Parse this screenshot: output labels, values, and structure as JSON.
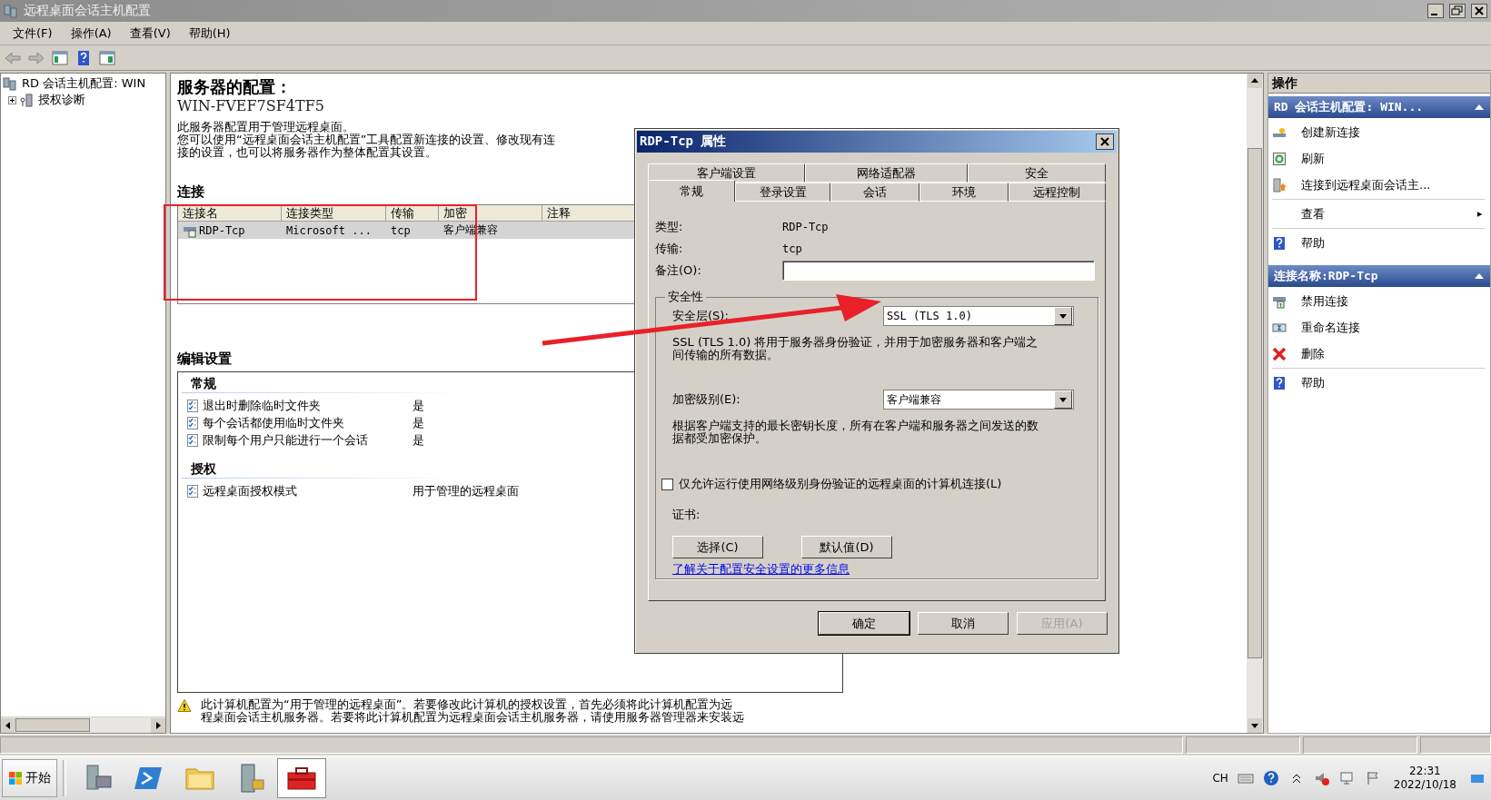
{
  "window": {
    "title": "远程桌面会话主机配置"
  },
  "menu": [
    "文件(F)",
    "操作(A)",
    "查看(V)",
    "帮助(H)"
  ],
  "tree": [
    {
      "label": "RD 会话主机配置: WIN",
      "selected": false,
      "children": [
        {
          "label": "授权诊断",
          "selected": false,
          "expanded": false
        }
      ]
    }
  ],
  "server": {
    "heading": "服务器的配置：",
    "name": "WIN-FVEF7SF4TF5",
    "description": [
      "此服务器配置用于管理远程桌面。",
      "您可以使用“远程桌面会话主机配置”工具配置新连接的设置、修改现有连",
      "接的设置，也可以将服务器作为整体配置其设置。"
    ]
  },
  "connections": {
    "title": "连接",
    "columns": [
      "连接名",
      "连接类型",
      "传输",
      "加密",
      "注释"
    ],
    "rows": [
      {
        "cells": [
          "RDP-Tcp",
          "Microsoft ...",
          "tcp",
          "客户端兼容"
        ],
        "selected": true
      }
    ]
  },
  "edit_settings": {
    "title": "编辑设置",
    "sections": [
      {
        "title": "常规",
        "items": [
          {
            "label": "退出时删除临时文件夹",
            "value": "是"
          },
          {
            "label": "每个会话都使用临时文件夹",
            "value": "是"
          },
          {
            "label": "限制每个用户只能进行一个会话",
            "value": "是"
          }
        ]
      },
      {
        "title": "授权",
        "items": [
          {
            "label": "远程桌面授权模式",
            "value": "用于管理的远程桌面"
          }
        ]
      }
    ]
  },
  "notice": [
    "此计算机配置为“用于管理的远程桌面”。若要修改此计算机的授权设置，首先必须将此计算机配置为远",
    "程桌面会话主机服务器。若要将此计算机配置为远程桌面会话主机服务器，请使用服务器管理器来安装远"
  ],
  "actions": {
    "title": "操作",
    "groups": [
      {
        "title": "RD 会话主机配置: WIN...",
        "expanded": true,
        "sections": [
          [
            {
              "label": "创建新连接",
              "submenu": false
            },
            {
              "label": "刷新",
              "submenu": false
            },
            {
              "label": "连接到远程桌面会话主...",
              "submenu": false
            }
          ],
          [
            {
              "label": "查看",
              "submenu": true
            }
          ],
          [
            {
              "label": "帮助",
              "submenu": false
            }
          ]
        ]
      },
      {
        "title": "连接名称:RDP-Tcp",
        "expanded": true,
        "sections": [
          [
            {
              "label": "禁用连接",
              "submenu": false
            },
            {
              "label": "重命名连接",
              "submenu": false
            },
            {
              "label": "删除",
              "submenu": false
            }
          ],
          [
            {
              "label": "帮助",
              "submenu": false
            }
          ]
        ]
      }
    ]
  },
  "dialog": {
    "title": "RDP-Tcp 属性",
    "tab_rows": [
      [
        {
          "label": "客户端设置",
          "selected": false
        },
        {
          "label": "网络适配器",
          "selected": false
        },
        {
          "label": "安全",
          "selected": false
        }
      ],
      [
        {
          "label": "常规",
          "selected": true
        },
        {
          "label": "登录设置",
          "selected": false
        },
        {
          "label": "会话",
          "selected": false
        },
        {
          "label": "环境",
          "selected": false
        },
        {
          "label": "远程控制",
          "selected": false
        }
      ]
    ],
    "fields": [
      {
        "kind": "text",
        "label": "类型:",
        "value": "RDP-Tcp"
      },
      {
        "kind": "text",
        "label": "传输:",
        "value": "tcp"
      },
      {
        "kind": "input",
        "label": "备注(O):"
      }
    ],
    "security": {
      "title": "安全性",
      "options": [
        {
          "label": "安全层(S):",
          "value": "SSL (TLS 1.0)",
          "description": "SSL (TLS 1.0) 将用于服务器身份验证，并用于加密服务器和客户端之间传输的所有数据。"
        },
        {
          "label": "加密级别(E):",
          "value": "客户端兼容",
          "description": "根据客户端支持的最长密钥长度，所有在客户端和服务器之间发送的数据都受加密保护。"
        }
      ],
      "checkbox": {
        "label": "仅允许运行使用网络级别身份验证的远程桌面的计算机连接(L)",
        "checked": false
      },
      "certificate": {
        "label": "证书:",
        "buttons": [
          "选择(C)",
          "默认值(D)"
        ]
      },
      "link": "了解关于配置安全设置的更多信息"
    },
    "buttons": [
      {
        "label": "确定",
        "default": true,
        "disabled": false
      },
      {
        "label": "取消",
        "default": false,
        "disabled": false
      },
      {
        "label": "应用(A)",
        "default": false,
        "disabled": true
      }
    ]
  },
  "taskbar": {
    "start": "开始",
    "apps": [
      {
        "selected": false
      },
      {
        "selected": false
      },
      {
        "selected": false
      },
      {
        "selected": false
      },
      {
        "selected": true
      }
    ],
    "language": "CH",
    "time": "22:31",
    "date": "2022/10/18"
  }
}
